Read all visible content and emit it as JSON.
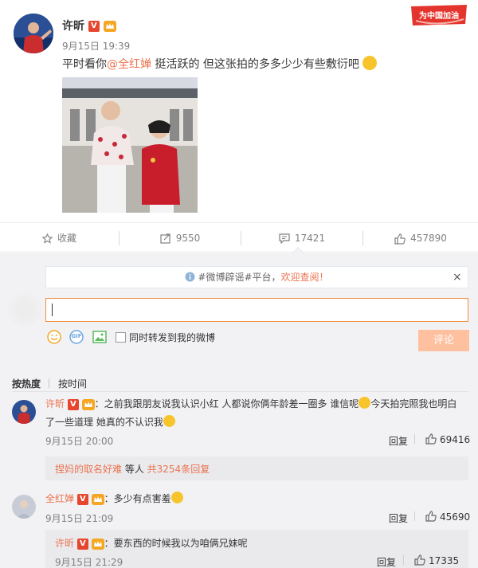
{
  "post": {
    "author": "许昕",
    "time": "9月15日 19:39",
    "text_prefix": "平时看你",
    "mention": "@全红婵",
    "text_suffix": " 挺活跃的 但这张拍的多多少少有些敷衍吧",
    "stamp_text": "为中国加油"
  },
  "actions": {
    "favorite": "收藏",
    "repost": "9550",
    "comment": "17421",
    "like": "457890"
  },
  "composer": {
    "notice_prefix": "#微博辟谣#平台，",
    "notice_link": "欢迎查阅！",
    "close": "×",
    "gif": "GIF",
    "forward_label": "同时转发到我的微博",
    "submit": "评论"
  },
  "sort": {
    "hot": "按热度",
    "time": "按时间"
  },
  "comments": [
    {
      "author": "许昕",
      "text1": "：之前我跟朋友说我认识小红 人都说你俩年龄差一圈多 谁信呢",
      "text2": "今天拍完照我也明白",
      "text3": "了一些道理 她真的不认识我",
      "time": "9月15日 20:00",
      "reply": "回复",
      "likes": "69416"
    },
    {
      "author": "全红婵",
      "text1": "：多少有点害羞",
      "time": "9月15日 21:09",
      "reply": "回复",
      "likes": "45690"
    }
  ],
  "sub_summary": {
    "name": "捏妈的取名好难",
    "middle": " 等人 ",
    "link": "共3254条回复"
  },
  "sub_reply": {
    "author": "许昕",
    "text": "：要东西的时候我以为咱俩兄妹呢",
    "time": "9月15日 21:29",
    "reply": "回复",
    "likes": "17335"
  },
  "colors": {
    "link": "#eb7350",
    "input_border": "#f08d3b",
    "submit_bg": "#ffc09f",
    "panel_bg": "#f2f2f5",
    "verified_badge": "#e6452e"
  }
}
